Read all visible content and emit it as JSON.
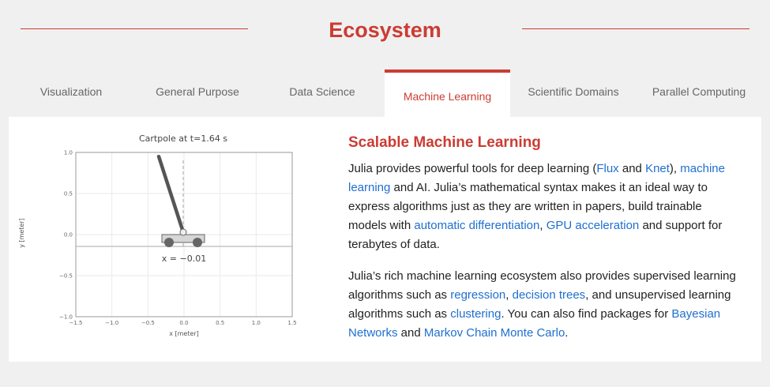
{
  "header": {
    "title": "Ecosystem"
  },
  "tabs": [
    {
      "label": "Visualization"
    },
    {
      "label": "General Purpose"
    },
    {
      "label": "Data Science"
    },
    {
      "label": "Machine Learning"
    },
    {
      "label": "Scientific Domains"
    },
    {
      "label": "Parallel Computing"
    }
  ],
  "active_tab": "Machine Learning",
  "plot": {
    "title": "Cartpole at t=1.64 s",
    "xlabel": "x [meter]",
    "ylabel": "y [meter]",
    "annotation": "x = −0.01",
    "x_ticks": [
      "−1.5",
      "−1.0",
      "−0.5",
      "0.0",
      "0.5",
      "1.0",
      "1.5"
    ],
    "y_ticks": [
      "1.0",
      "0.5",
      "0.0",
      "−0.5",
      "−1.0"
    ]
  },
  "chart_data": {
    "type": "scatter",
    "title": "Cartpole at t=1.64 s",
    "xlabel": "x [meter]",
    "ylabel": "y [meter]",
    "xlim": [
      -1.5,
      1.5
    ],
    "ylim": [
      -1.0,
      1.0
    ],
    "grid": true,
    "cart_position": -0.01,
    "pole_tip": [
      -0.35,
      0.95
    ]
  },
  "section": {
    "heading": "Scalable Machine Learning",
    "p1": {
      "t1": "Julia provides powerful tools for deep learning (",
      "link_flux": "Flux",
      "t2": " and ",
      "link_knet": "Knet",
      "t3": "), ",
      "link_ml": "machine learning",
      "t4": " and AI. Julia’s mathematical syntax makes it an ideal way to express algorithms just as they are written in papers, build trainable models with ",
      "link_autodiff": "automatic differentiation",
      "t5": ", ",
      "link_gpu": "GPU acceleration",
      "t6": " and support for terabytes of data."
    },
    "p2": {
      "t1": "Julia’s rich machine learning ecosystem also provides supervised learning algorithms such as ",
      "link_regression": "regression",
      "t2": ", ",
      "link_trees": "decision trees",
      "t3": ", and unsupervised learning algorithms such as ",
      "link_clustering": "clustering",
      "t4": ". You can also find packages for ",
      "link_bayes": "Bayesian Networks",
      "t5": " and ",
      "link_mcmc": "Markov Chain Monte Carlo",
      "t6": "."
    }
  }
}
